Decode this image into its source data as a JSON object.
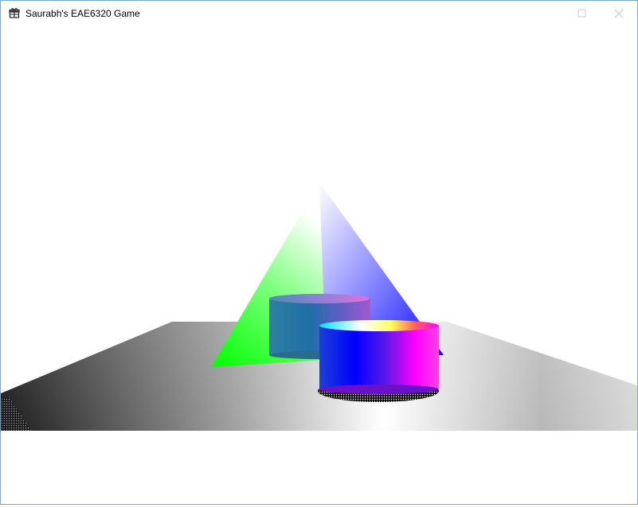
{
  "window": {
    "title": "Saurabh's EAE6320 Game",
    "app_icon": "gift-icon",
    "controls": [
      "maximize-icon",
      "close-icon"
    ],
    "border_color": "#7aa6d6",
    "titlebar_background": "#ffffff",
    "control_color": "#c9c9c9"
  },
  "scene": {
    "background": "#ffffff",
    "objects": [
      {
        "kind": "ground-plane",
        "colors": [
          "#ffffff",
          "#808080",
          "#1a1a1a"
        ]
      },
      {
        "kind": "pyramid",
        "colors": [
          "#00ff00",
          "#0000ff",
          "#ffffff"
        ]
      },
      {
        "kind": "cylinder",
        "colors": [
          "#1a6fa5",
          "#8d5fd0",
          "#ff00ff"
        ]
      },
      {
        "kind": "cylinder",
        "colors": [
          "#0000ff",
          "#ff00ff",
          "#ffffff",
          "#00ffff"
        ]
      }
    ]
  }
}
